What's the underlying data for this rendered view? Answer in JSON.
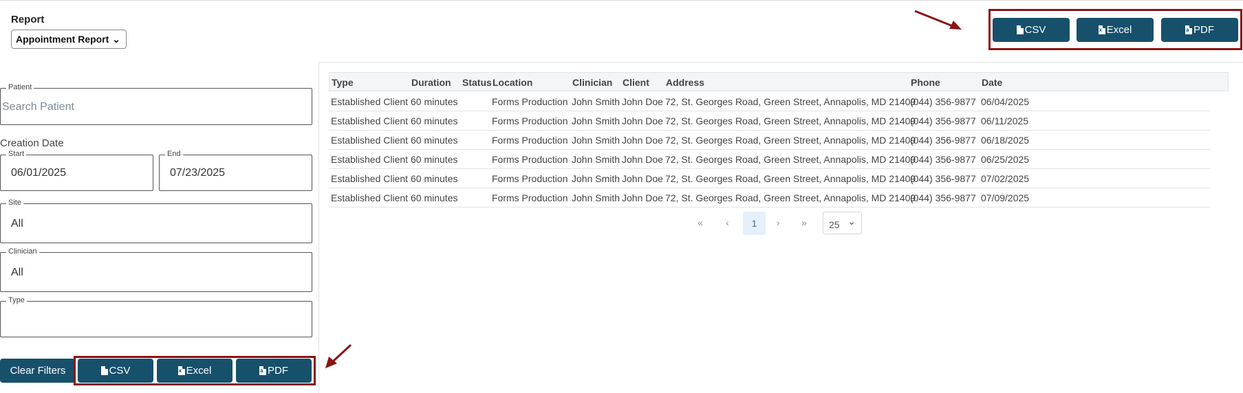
{
  "report": {
    "label": "Report",
    "selected": "Appointment Report"
  },
  "filters": {
    "patient": {
      "legend": "Patient",
      "placeholder": "Search Patient"
    },
    "creation_date_label": "Creation Date",
    "start": {
      "legend": "Start",
      "value": "06/01/2025"
    },
    "end": {
      "legend": "End",
      "value": "07/23/2025"
    },
    "site": {
      "legend": "Site",
      "value": "All"
    },
    "clinician": {
      "legend": "Clinician",
      "value": "All"
    },
    "type": {
      "legend": "Type",
      "value": ""
    },
    "clear_label": "Clear Filters"
  },
  "export": {
    "csv": "CSV",
    "excel": "Excel",
    "pdf": "PDF"
  },
  "table": {
    "headers": [
      "Type",
      "Duration",
      "Status",
      "Location",
      "Clinician",
      "Client",
      "Address",
      "Phone",
      "Date"
    ],
    "rows": [
      [
        "Established Client",
        "60 minutes",
        "",
        "Forms Production",
        "John Smith",
        "John Doe",
        "72, St. Georges Road, Green Street, Annapolis, MD 21409",
        "(044) 356-9877",
        "06/04/2025"
      ],
      [
        "Established Client",
        "60 minutes",
        "",
        "Forms Production",
        "John Smith",
        "John Doe",
        "72, St. Georges Road, Green Street, Annapolis, MD 21409",
        "(044) 356-9877",
        "06/11/2025"
      ],
      [
        "Established Client",
        "60 minutes",
        "",
        "Forms Production",
        "John Smith",
        "John Doe",
        "72, St. Georges Road, Green Street, Annapolis, MD 21409",
        "(044) 356-9877",
        "06/18/2025"
      ],
      [
        "Established Client",
        "60 minutes",
        "",
        "Forms Production",
        "John Smith",
        "John Doe",
        "72, St. Georges Road, Green Street, Annapolis, MD 21409",
        "(044) 356-9877",
        "06/25/2025"
      ],
      [
        "Established Client",
        "60 minutes",
        "",
        "Forms Production",
        "John Smith",
        "John Doe",
        "72, St. Georges Road, Green Street, Annapolis, MD 21409",
        "(044) 356-9877",
        "07/02/2025"
      ],
      [
        "Established Client",
        "60 minutes",
        "",
        "Forms Production",
        "John Smith",
        "John Doe",
        "72, St. Georges Road, Green Street, Annapolis, MD 21409",
        "(044) 356-9877",
        "07/09/2025"
      ]
    ]
  },
  "pagination": {
    "first": "«",
    "prev": "‹",
    "current": "1",
    "next": "›",
    "last": "»",
    "page_size": "25"
  },
  "colors": {
    "button": "#17506b",
    "highlight": "#8b1414"
  },
  "icons": {
    "doc": "file-icon",
    "excel": "excel-file-icon",
    "pdf": "pdf-file-icon"
  }
}
